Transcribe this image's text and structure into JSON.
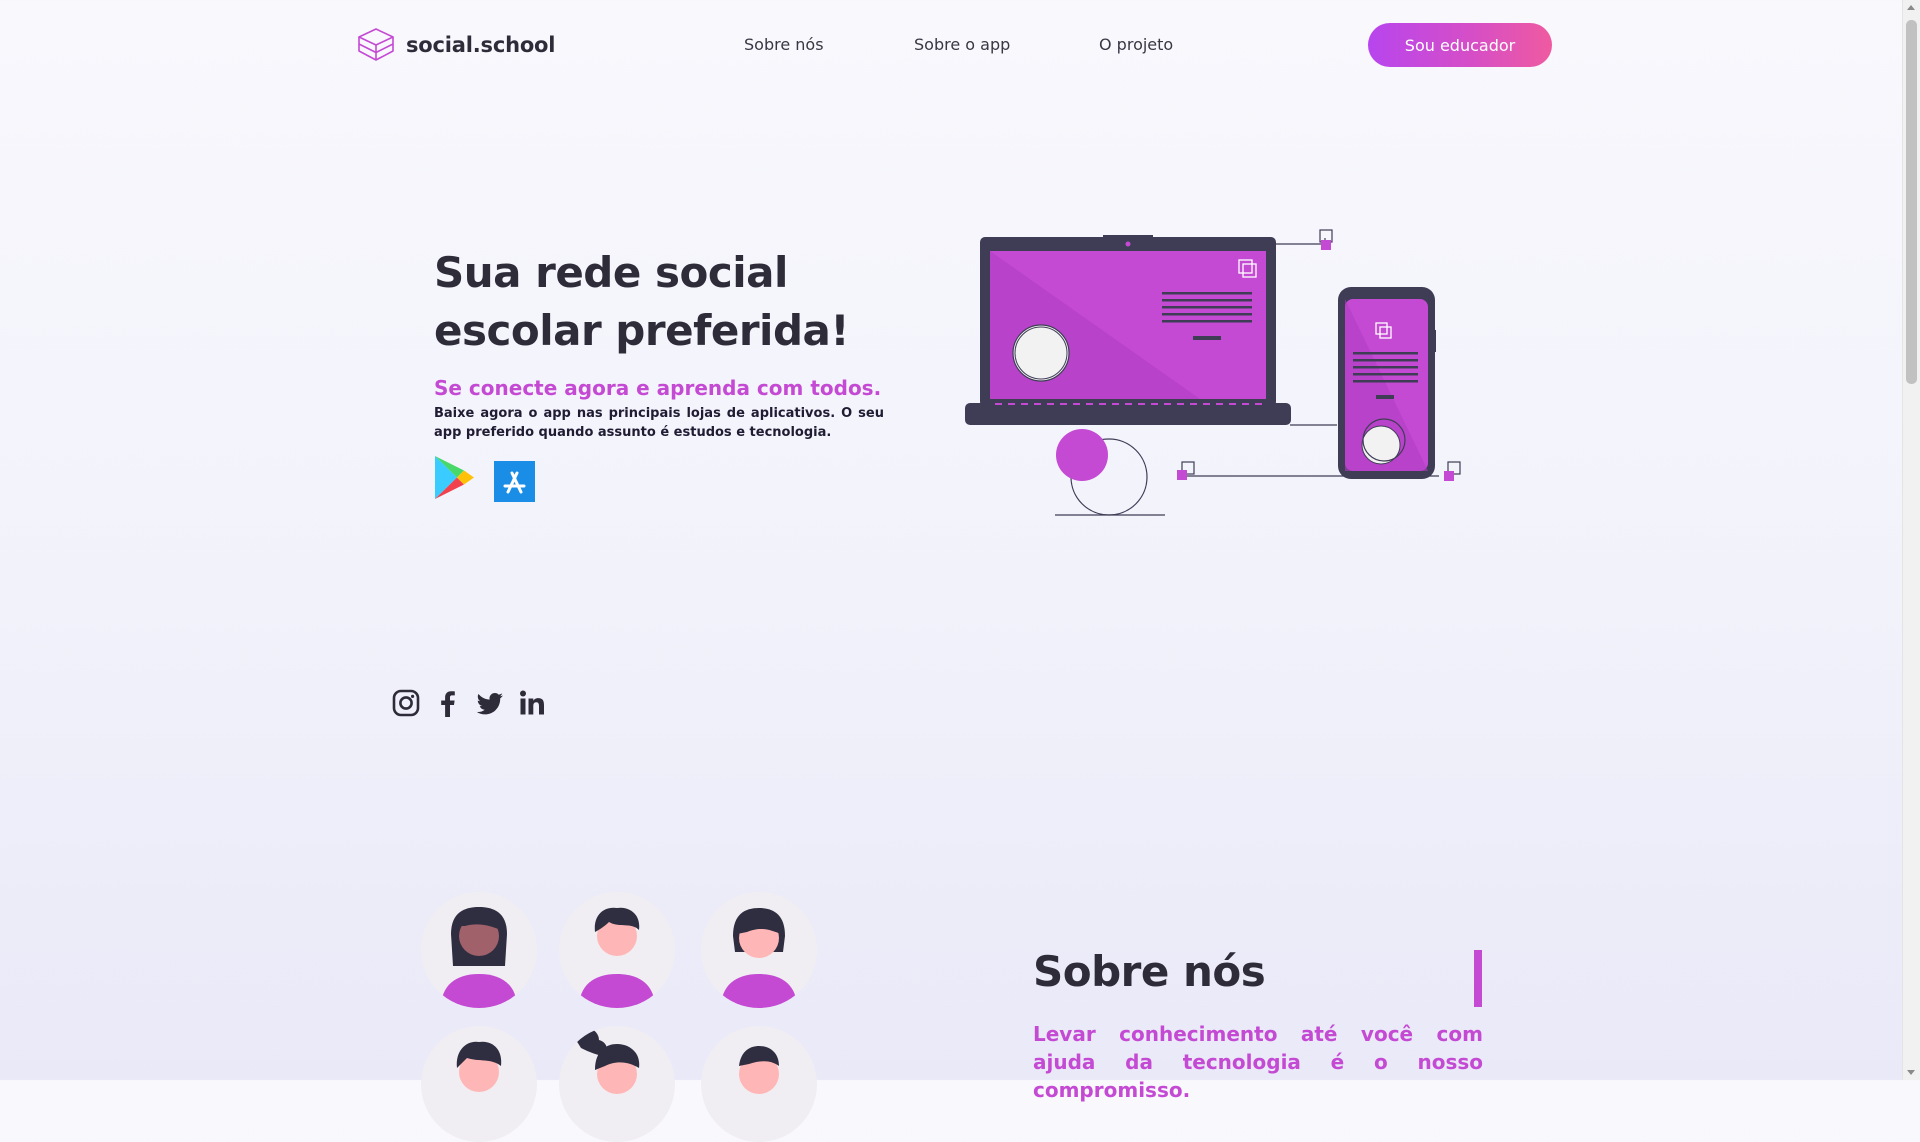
{
  "header": {
    "logo_text": "social.school",
    "nav": [
      "Sobre nós",
      "Sobre o app",
      "O projeto"
    ],
    "cta_label": "Sou educador"
  },
  "hero": {
    "title": "Sua rede social escolar preferida!",
    "subtitle": "Se conecte agora e aprenda com todos.",
    "description": "Baixe agora o app nas principais lojas de aplicativos. O seu app preferido quando assunto é estudos e tecnologia.",
    "stores": [
      "google-play-icon",
      "app-store-icon"
    ]
  },
  "social": [
    "instagram-icon",
    "facebook-icon",
    "twitter-icon",
    "linkedin-icon"
  ],
  "about": {
    "title": "Sobre nós",
    "text": "Levar conhecimento até você com ajuda da tecnologia é o nosso compromisso."
  },
  "colors": {
    "accent": "#c44ad4",
    "dark": "#2f2c3a",
    "cta_start": "#b745ee",
    "cta_end": "#ef5aa0"
  }
}
